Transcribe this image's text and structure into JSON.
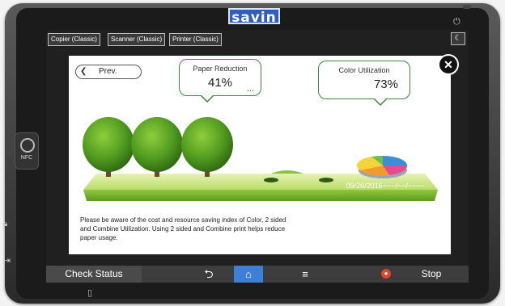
{
  "device": {
    "brand": "savin",
    "nfc_label": "NFC"
  },
  "app_tabs": [
    "Copier (Classic)",
    "Scanner (Classic)",
    "Printer (Classic)"
  ],
  "dialog": {
    "prev_label": "Prev.",
    "paper_reduction": {
      "title": "Paper Reduction",
      "value": "41%",
      "more": "..."
    },
    "color_utilization": {
      "title": "Color Utilization",
      "value": "73%"
    },
    "date_range": "09/26/2016~~~/~~/~~~~",
    "description": "Please be aware of the cost and resource saving index of Color, 2 sided and Combine Utilization. Using 2 sided and Combine print helps reduce paper usage.",
    "trees_count": 3,
    "close_symbol": "✕"
  },
  "bottom_bar": {
    "check_status": "Check Status",
    "stop": "Stop"
  },
  "colors": {
    "accent_green": "#3a8a3a",
    "home_blue": "#3e7fd8",
    "stop_red": "#e2452a",
    "brand_blue": "#2f5fb8"
  }
}
